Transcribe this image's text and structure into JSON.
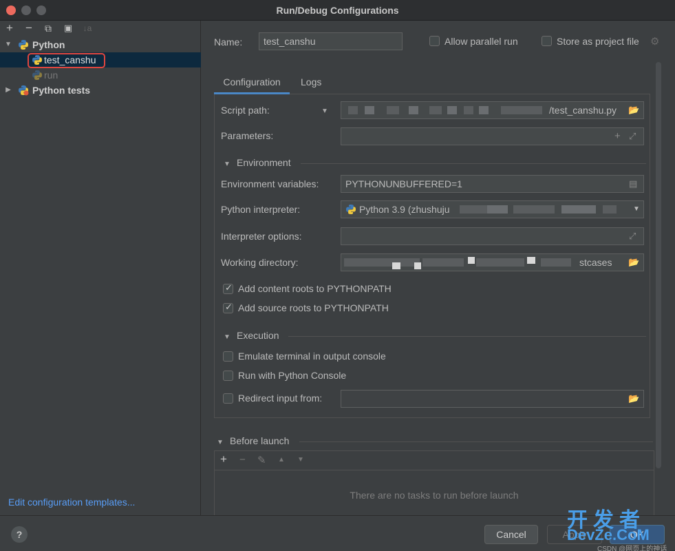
{
  "window": {
    "title": "Run/Debug Configurations"
  },
  "toolbar": {
    "add": "+",
    "remove": "−",
    "copy": "⧉",
    "folder": "▣",
    "sort": "↓a"
  },
  "tree": {
    "python_group": "Python",
    "selected_item": "test_canshu",
    "run_item": "run",
    "python_tests_group": "Python tests"
  },
  "left_footer": {
    "edit_templates": "Edit configuration templates..."
  },
  "header": {
    "name_label": "Name:",
    "name_value": "test_canshu",
    "allow_parallel": "Allow parallel run",
    "store_project": "Store as project file"
  },
  "tabs": [
    {
      "label": "Configuration"
    },
    {
      "label": "Logs"
    }
  ],
  "config": {
    "script_path_label": "Script path:",
    "script_path_value": "/test_canshu.py",
    "parameters_label": "Parameters:",
    "environment_section": "Environment",
    "env_vars_label": "Environment variables:",
    "env_vars_value": "PYTHONUNBUFFERED=1",
    "interpreter_label": "Python interpreter:",
    "interpreter_value": "Python 3.9 (zhushuju",
    "interpreter_options_label": "Interpreter options:",
    "working_dir_label": "Working directory:",
    "working_dir_value": "stcases",
    "add_content_roots": "Add content roots to PYTHONPATH",
    "add_source_roots": "Add source roots to PYTHONPATH",
    "execution_section": "Execution",
    "emulate_terminal": "Emulate terminal in output console",
    "run_python_console": "Run with Python Console",
    "redirect_input": "Redirect input from:"
  },
  "before_launch": {
    "label": "Before launch",
    "empty_message": "There are no tasks to run before launch"
  },
  "buttons": {
    "help": "?",
    "cancel": "Cancel",
    "apply": "Apply",
    "ok": "OK"
  },
  "watermark": {
    "line1": "开发者",
    "line2": "DevZe.CoM",
    "line3": "CSDN @网页上的神话"
  },
  "colors": {
    "accent": "#4a88c7",
    "link": "#589df6",
    "highlight": "#e0463f",
    "selection": "#0d293e"
  }
}
